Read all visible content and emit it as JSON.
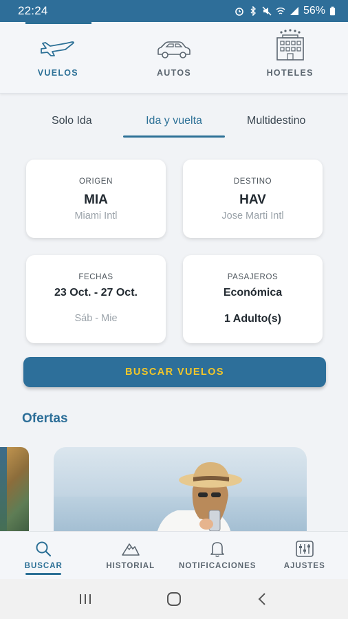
{
  "status_bar": {
    "time": "22:24",
    "battery": "56%"
  },
  "categories": [
    {
      "label": "VUELOS",
      "icon": "airplane-icon",
      "active": true
    },
    {
      "label": "AUTOS",
      "icon": "car-icon",
      "active": false
    },
    {
      "label": "HOTELES",
      "icon": "hotel-icon",
      "active": false
    }
  ],
  "trip_types": [
    "Solo Ida",
    "Ida y vuelta",
    "Multidestino"
  ],
  "origin": {
    "label": "ORIGEN",
    "code": "MIA",
    "name": "Miami Intl"
  },
  "destination": {
    "label": "DESTINO",
    "code": "HAV",
    "name": "Jose Marti Intl"
  },
  "dates": {
    "label": "FECHAS",
    "range": "23 Oct. - 27 Oct.",
    "days": "Sáb - Mie"
  },
  "passengers": {
    "label": "PASAJEROS",
    "cabin": "Económica",
    "count": "1 Adulto(s)"
  },
  "search_button": "BUSCAR VUELOS",
  "offers_title": "Ofertas",
  "bottom_nav": [
    {
      "label": "BUSCAR",
      "icon": "search-icon",
      "active": true
    },
    {
      "label": "HISTORIAL",
      "icon": "mountain-icon",
      "active": false
    },
    {
      "label": "NOTIFICACIONES",
      "icon": "bell-icon",
      "active": false
    },
    {
      "label": "AJUSTES",
      "icon": "sliders-icon",
      "active": false
    }
  ],
  "colors": {
    "primary": "#2d6f9a",
    "accent": "#f3c72a",
    "status_bar": "#2e6e99"
  }
}
